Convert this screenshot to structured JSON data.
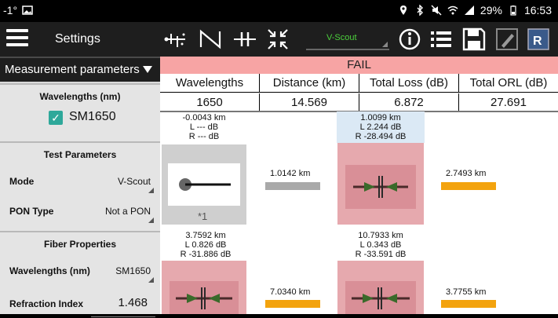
{
  "status_bar": {
    "left_text": "-1°",
    "battery": "29%",
    "time": "16:53"
  },
  "sidebar": {
    "title": "Settings",
    "section_header": "Measurement parameters",
    "wavelengths_section": {
      "title": "Wavelengths (nm)",
      "checkbox_label": "SM1650",
      "checked": true
    },
    "test_parameters": {
      "title": "Test Parameters",
      "mode_label": "Mode",
      "mode_value": "V-Scout",
      "pon_label": "PON Type",
      "pon_value": "Not a PON"
    },
    "fiber_properties": {
      "title": "Fiber Properties",
      "wavelengths_label": "Wavelengths (nm)",
      "wavelengths_value": "SM1650",
      "refraction_label": "Refraction Index",
      "refraction_value": "1.468"
    }
  },
  "toolbar": {
    "mode_select": "V-Scout",
    "icons": [
      "trace-view-icon",
      "n-trace-icon",
      "connector-events-icon",
      "compress-icon",
      "info-icon",
      "list-icon",
      "save-icon",
      "edit-icon",
      "report-icon"
    ]
  },
  "result": {
    "status": "FAIL",
    "status_color": "#f7a4a4",
    "headers": [
      "Wavelengths",
      "Distance (km)",
      "Total Loss (dB)",
      "Total ORL (dB)"
    ],
    "values": [
      "1650",
      "14.569",
      "6.872",
      "27.691"
    ]
  },
  "events": [
    {
      "line1": "-0.0043 km",
      "line2": "L --- dB",
      "line3": "R --- dB",
      "footnote": "*1"
    },
    {
      "line1": "1.0099 km",
      "line2": "L 2.244 dB",
      "line3": "R -28.494 dB"
    },
    {
      "line1": "3.7592 km",
      "line2": "L 0.826 dB",
      "line3": "R -31.886 dB"
    },
    {
      "line1": "10.7933 km",
      "line2": "L 0.343 dB",
      "line3": "R -33.591 dB"
    }
  ],
  "gaps": [
    {
      "label": "1.0142 km",
      "color": "#a9a9a9"
    },
    {
      "label": "2.7493 km",
      "color": "#f3a30e"
    },
    {
      "label": "7.0340 km",
      "color": "#f3a30e"
    },
    {
      "label": "3.7755 km",
      "color": "#f3a30e"
    }
  ]
}
